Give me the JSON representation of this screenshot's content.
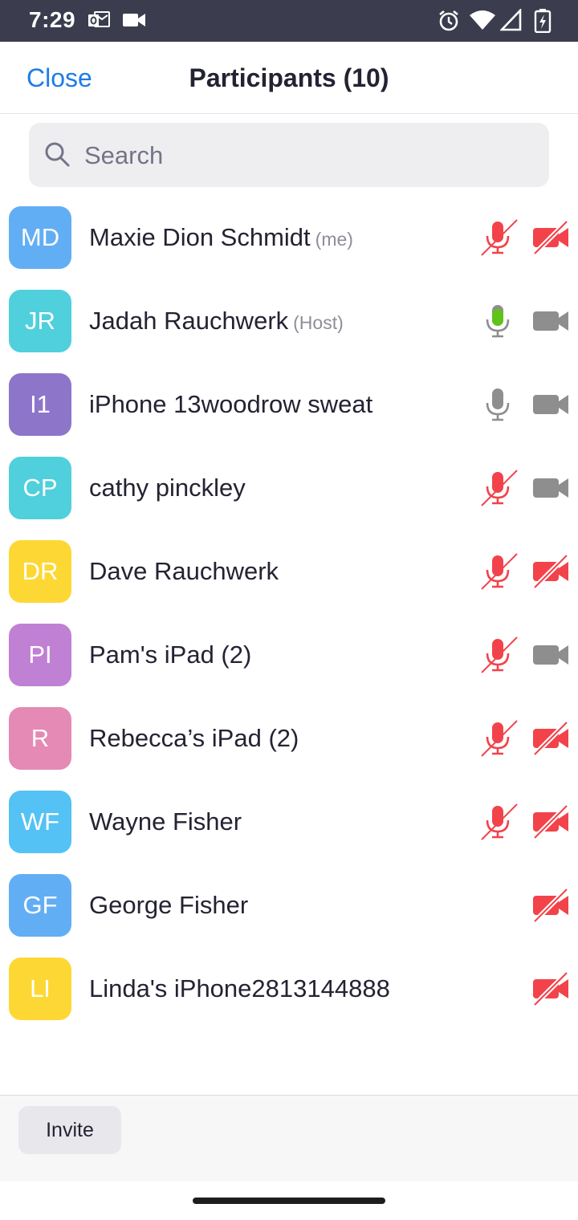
{
  "status_bar": {
    "time": "7:29",
    "left_icons": [
      "outlook-icon",
      "video-camera-icon"
    ],
    "right_icons": [
      "alarm-icon",
      "wifi-icon",
      "cell-signal-icon",
      "battery-charging-icon"
    ]
  },
  "header": {
    "close_label": "Close",
    "title": "Participants (10)"
  },
  "search": {
    "placeholder": "Search"
  },
  "participants": [
    {
      "initials": "MD",
      "name": "Maxie Dion Schmidt",
      "tag": "(me)",
      "avatar_color": "#62aef4",
      "mic": "muted",
      "video": "off"
    },
    {
      "initials": "JR",
      "name": "Jadah Rauchwerk",
      "tag": "(Host)",
      "avatar_color": "#50cfdc",
      "mic": "active",
      "video": "on"
    },
    {
      "initials": "I1",
      "name": "iPhone 13woodrow sweat",
      "tag": "",
      "avatar_color": "#8d76ca",
      "mic": "on",
      "video": "on"
    },
    {
      "initials": "CP",
      "name": "cathy pinckley",
      "tag": "",
      "avatar_color": "#50cfdc",
      "mic": "muted",
      "video": "on"
    },
    {
      "initials": "DR",
      "name": "Dave Rauchwerk",
      "tag": "",
      "avatar_color": "#fdd835",
      "mic": "muted",
      "video": "off"
    },
    {
      "initials": "PI",
      "name": "Pam's iPad (2)",
      "tag": "",
      "avatar_color": "#c080d4",
      "mic": "muted",
      "video": "on"
    },
    {
      "initials": "R",
      "name": "Rebecca’s iPad (2)",
      "tag": "",
      "avatar_color": "#e48ab4",
      "mic": "muted",
      "video": "off"
    },
    {
      "initials": "WF",
      "name": "Wayne Fisher",
      "tag": "",
      "avatar_color": "#54c2f4",
      "mic": "muted",
      "video": "off"
    },
    {
      "initials": "GF",
      "name": "George Fisher",
      "tag": "",
      "avatar_color": "#62aef4",
      "mic": "none",
      "video": "off"
    },
    {
      "initials": "LI",
      "name": "Linda's iPhone2813144888",
      "tag": "",
      "avatar_color": "#fdd835",
      "mic": "none",
      "video": "off"
    }
  ],
  "footer": {
    "invite_label": "Invite"
  },
  "colors": {
    "accent": "#1f7ce6",
    "muted_red": "#f2434b",
    "active_green": "#5fc31a",
    "icon_gray": "#8e8e8e"
  }
}
